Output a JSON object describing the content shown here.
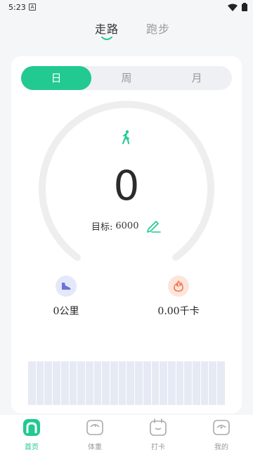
{
  "status_bar": {
    "time": "5:23",
    "a_label": "A"
  },
  "top_tabs": [
    {
      "label": "走路"
    },
    {
      "label": "跑步"
    }
  ],
  "period_tabs": [
    {
      "label": "日"
    },
    {
      "label": "周"
    },
    {
      "label": "月"
    }
  ],
  "steps": {
    "value": "0",
    "goal_label": "目标:",
    "goal_value": "6000",
    "progress": 0
  },
  "metrics": {
    "distance": "0公里",
    "calories": "0.00千卡"
  },
  "bottom_nav": [
    {
      "label": "首页"
    },
    {
      "label": "体重"
    },
    {
      "label": "打卡"
    },
    {
      "label": "我的"
    }
  ],
  "colors": {
    "accent": "#22c990",
    "ring_track": "#eeeeee",
    "bar": "#e6eaf4",
    "distance_icon_bg": "#e5e8fb",
    "calorie_icon_bg": "#fde5dc",
    "calorie_icon": "#f0734e"
  },
  "icons": {
    "walk": "walking-person-icon",
    "edit": "pencil-icon",
    "distance": "shoe-icon",
    "calories": "flame-icon",
    "home": "home-icon",
    "weight": "scale-icon",
    "checkin": "calendar-icon",
    "mine": "profile-icon"
  }
}
